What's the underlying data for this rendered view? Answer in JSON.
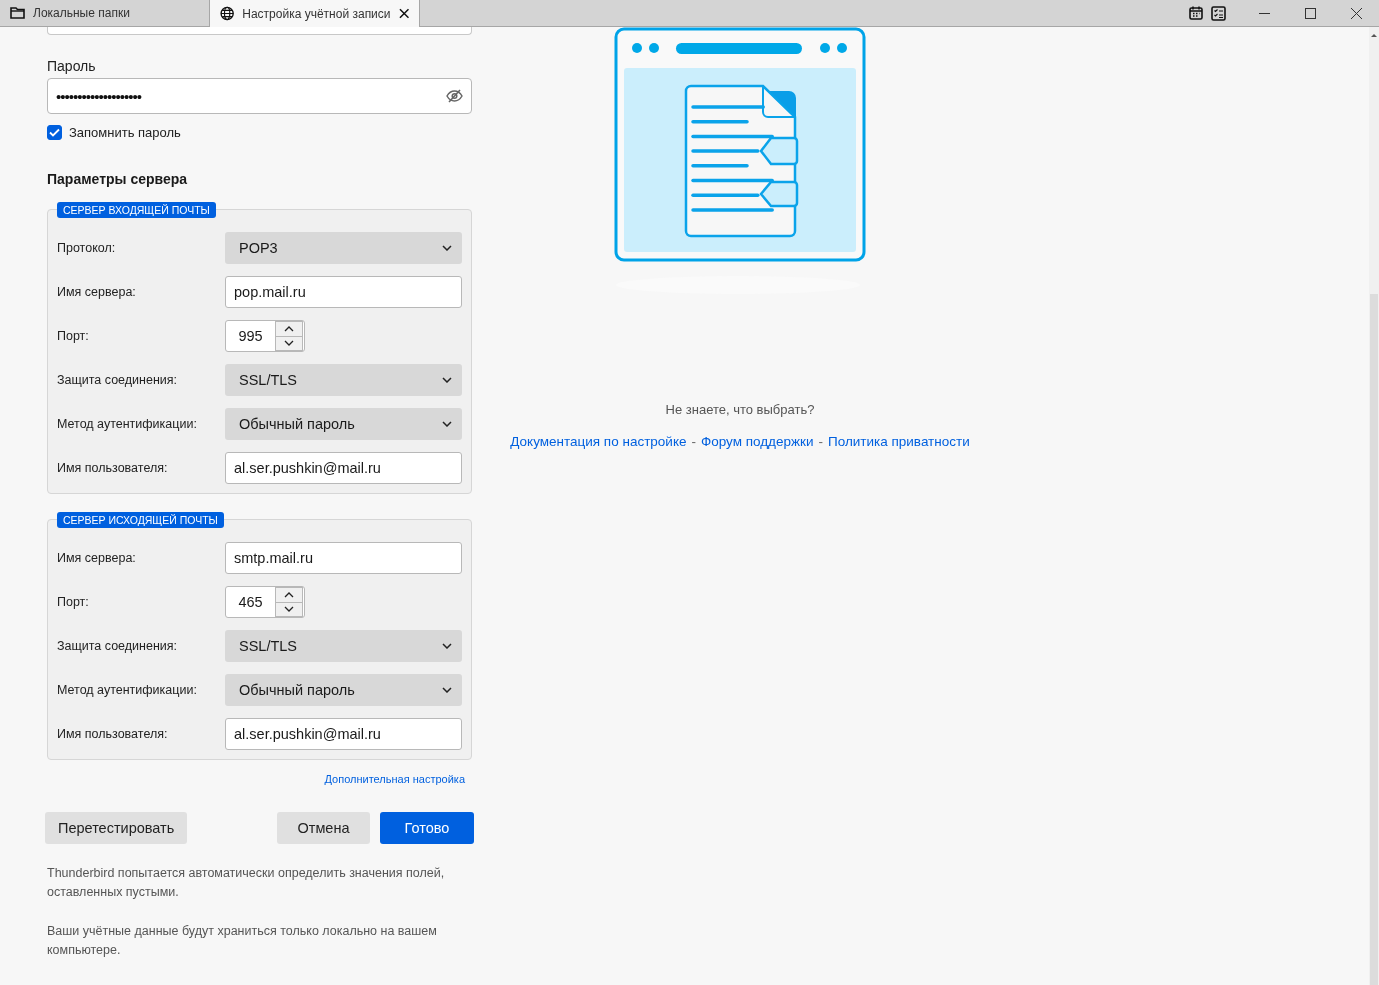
{
  "tabs": [
    {
      "kind": "folder",
      "label": "Локальные папки",
      "selected": false,
      "closable": false
    },
    {
      "kind": "globe",
      "label": "Настройка учётной записи",
      "selected": true,
      "closable": true
    }
  ],
  "password": {
    "label": "Пароль",
    "value": "••••••••••••••••••••"
  },
  "remember": {
    "label": "Запомнить пароль",
    "checked": true
  },
  "server_heading": "Параметры сервера",
  "groups": [
    {
      "legend": "СЕРВЕР ВХОДЯЩЕЙ ПОЧТЫ",
      "rows": [
        {
          "kind": "select",
          "label": "Протокол:",
          "value": "POP3"
        },
        {
          "kind": "text",
          "label": "Имя сервера:",
          "value": "pop.mail.ru"
        },
        {
          "kind": "spin",
          "label": "Порт:",
          "value": "995"
        },
        {
          "kind": "select",
          "label": "Защита соединения:",
          "value": "SSL/TLS"
        },
        {
          "kind": "select",
          "label": "Метод аутентификации:",
          "value": "Обычный пароль"
        },
        {
          "kind": "text",
          "label": "Имя пользователя:",
          "value": "al.ser.pushkin@mail.ru"
        }
      ]
    },
    {
      "legend": "СЕРВЕР ИСХОДЯЩЕЙ ПОЧТЫ",
      "rows": [
        {
          "kind": "text",
          "label": "Имя сервера:",
          "value": "smtp.mail.ru"
        },
        {
          "kind": "spin",
          "label": "Порт:",
          "value": "465"
        },
        {
          "kind": "select",
          "label": "Защита соединения:",
          "value": "SSL/TLS"
        },
        {
          "kind": "select",
          "label": "Метод аутентификации:",
          "value": "Обычный пароль"
        },
        {
          "kind": "text",
          "label": "Имя пользователя:",
          "value": "al.ser.pushkin@mail.ru"
        }
      ]
    }
  ],
  "advanced_link": "Дополнительная настройка",
  "buttons": [
    {
      "kind": "secondary",
      "label": "Перетестировать"
    },
    {
      "kind": "secondary",
      "label": "Отмена"
    },
    {
      "kind": "primary",
      "label": "Готово"
    }
  ],
  "notes": [
    "Thunderbird попытается автоматически определить значения полей, оставленных пустыми.",
    "Ваши учётные данные будут храниться только локально на вашем компьютере."
  ],
  "help": {
    "question": "Не знаете, что выбрать?",
    "links": [
      "Документация по настройке",
      "Форум поддержки",
      "Политика приватности"
    ],
    "separator": "-"
  }
}
